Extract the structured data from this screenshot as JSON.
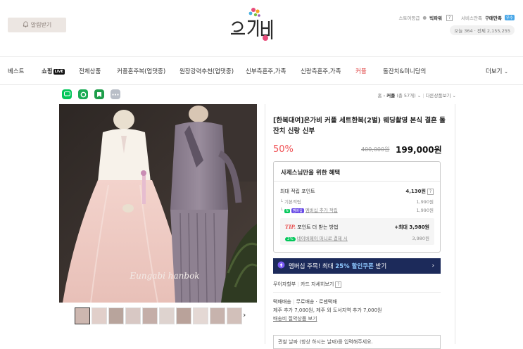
{
  "header": {
    "alarm_label": "알림받기",
    "store_grade_label": "스토어등급",
    "store_grade_value": "빅파워",
    "service_label": "서비스만족",
    "service_value": "구매만족",
    "service_badge": "우수",
    "today_visits": "오늘 364",
    "total_visits": "전체 2,155,255"
  },
  "nav": {
    "items": [
      "베스트",
      "쇼핑",
      "전체상품",
      "커플혼주복(업댓중)",
      "원장강력추천(업댓중)",
      "신부측혼주,가족",
      "신랑측혼주,가족",
      "커플",
      "돌잔치&미니당의"
    ],
    "live_badge": "LIVE",
    "more": "더보기"
  },
  "breadcrumb": {
    "home": "홈",
    "current": "커플",
    "count": "(총 57개)",
    "sep": "›",
    "next": "다른상품보기"
  },
  "product": {
    "title": "[한복대여]은가비 커플 세트한복(2벌) 웨딩촬영 본식 결혼 돌잔치 신랑 신부",
    "discount": "50%",
    "original_price": "400,000원",
    "price": "199,000원",
    "image_watermark": "Eungabi hanbok"
  },
  "benefit": {
    "title": "사제스님만을 위한 혜택",
    "max_point_label": "최대 적립 포인트",
    "max_point_value": "4,130원",
    "basic_label": "기본적립",
    "basic_value": "1,990원",
    "member_badge": "멤버십",
    "member_label": "멤버십 추가 적립",
    "member_value": "1,990원",
    "tip_label": "TIP.",
    "tip_text": "포인트 더 받는 방법",
    "tip_value": "+최대 3,980원",
    "pay_badge": "2%",
    "pay_label": "네이버페이 머니로 결제 시",
    "pay_value": "3,980원"
  },
  "membership_banner": {
    "text_prefix": "멤버십 주목! 최대",
    "highlight": "25% 할인쿠폰",
    "text_suffix": "받기"
  },
  "installment": {
    "label": "무이자할부",
    "card": "카드 자세히보기"
  },
  "shipping": {
    "type": "택배배송",
    "free": "무료배송",
    "carrier": "로젠택배",
    "extra": "제주 추가 7,000원, 제주 외 도서지역 추가 7,000원",
    "calc_link": "배송비 절약상품 보기"
  },
  "request": {
    "placeholder": "관찰 날짜 (항상 하시는 날짜)를 입력해주세요."
  },
  "colors": {
    "discount": "#f05054",
    "banner_bg": "#1c2a5a",
    "naver_green": "#03c75a",
    "alarm_bg": "#ece6e2"
  }
}
